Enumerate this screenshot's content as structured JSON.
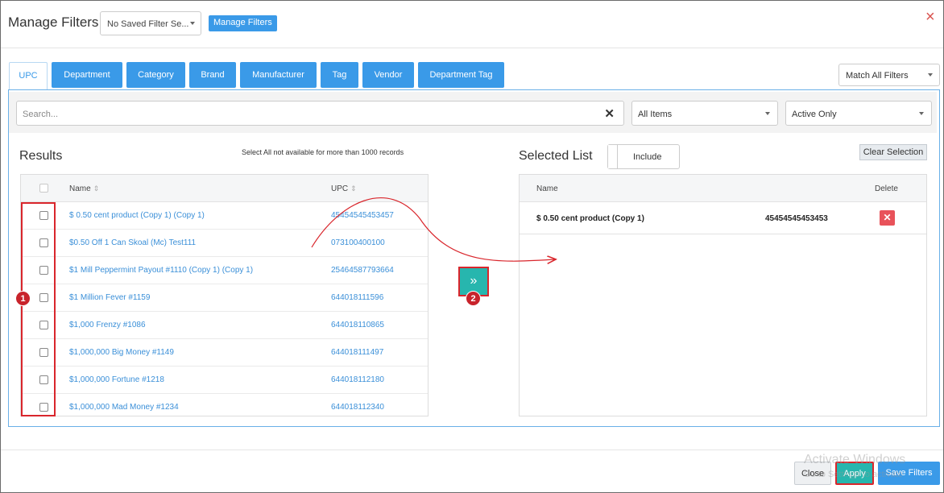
{
  "header": {
    "title": "Manage Filters",
    "saved_filter_value": "No Saved Filter Se...",
    "manage_filters_button": "Manage Filters",
    "close_symbol": "×"
  },
  "tabs": [
    {
      "label": "UPC",
      "active": true
    },
    {
      "label": "Department",
      "active": false
    },
    {
      "label": "Category",
      "active": false
    },
    {
      "label": "Brand",
      "active": false
    },
    {
      "label": "Manufacturer",
      "active": false
    },
    {
      "label": "Tag",
      "active": false
    },
    {
      "label": "Vendor",
      "active": false
    },
    {
      "label": "Department Tag",
      "active": false
    }
  ],
  "match_select": {
    "value": "Match All Filters"
  },
  "search": {
    "placeholder": "Search...",
    "clear_symbol": "✕"
  },
  "items_select": {
    "value": "All Items"
  },
  "status_select": {
    "value": "Active Only"
  },
  "results": {
    "title": "Results",
    "note": "Select All not available for more than 1000 records",
    "columns": {
      "name": "Name",
      "upc": "UPC",
      "sort_symbol": "⇕"
    },
    "rows": [
      {
        "name": "$ 0.50 cent product (Copy 1) (Copy 1)",
        "upc": "45454545453457"
      },
      {
        "name": "$0.50 Off 1 Can Skoal (Mc) Test111",
        "upc": "073100400100"
      },
      {
        "name": "$1 Mill Peppermint Payout #1110 (Copy 1) (Copy 1)",
        "upc": "25464587793664"
      },
      {
        "name": "$1 Million Fever #1159",
        "upc": "644018111596"
      },
      {
        "name": "$1,000 Frenzy #1086",
        "upc": "644018110865"
      },
      {
        "name": "$1,000,000 Big Money #1149",
        "upc": "644018111497"
      },
      {
        "name": "$1,000,000 Fortune #1218",
        "upc": "644018112180"
      },
      {
        "name": "$1,000,000 Mad Money #1234",
        "upc": "644018112340"
      }
    ]
  },
  "move_button": {
    "symbol": "»"
  },
  "annotations": {
    "badge_1": "1",
    "badge_2": "2"
  },
  "selected": {
    "title": "Selected List",
    "include_label": "Include",
    "clear_button": "Clear Selection",
    "columns": {
      "name": "Name",
      "delete": "Delete"
    },
    "rows": [
      {
        "name": "$ 0.50 cent product (Copy 1)",
        "upc": "45454545453453",
        "delete_symbol": "✕"
      }
    ]
  },
  "footer": {
    "close": "Close",
    "apply": "Apply",
    "save": "Save Filters",
    "watermark_line1": "Activate Windows",
    "watermark_line2": "Go to Settings to activate"
  },
  "colors": {
    "primary": "#3a9ae8",
    "teal": "#27b6ae",
    "annotation_red": "#d9262c",
    "delete_red": "#e8525a",
    "link_blue": "#3a8fd8"
  }
}
